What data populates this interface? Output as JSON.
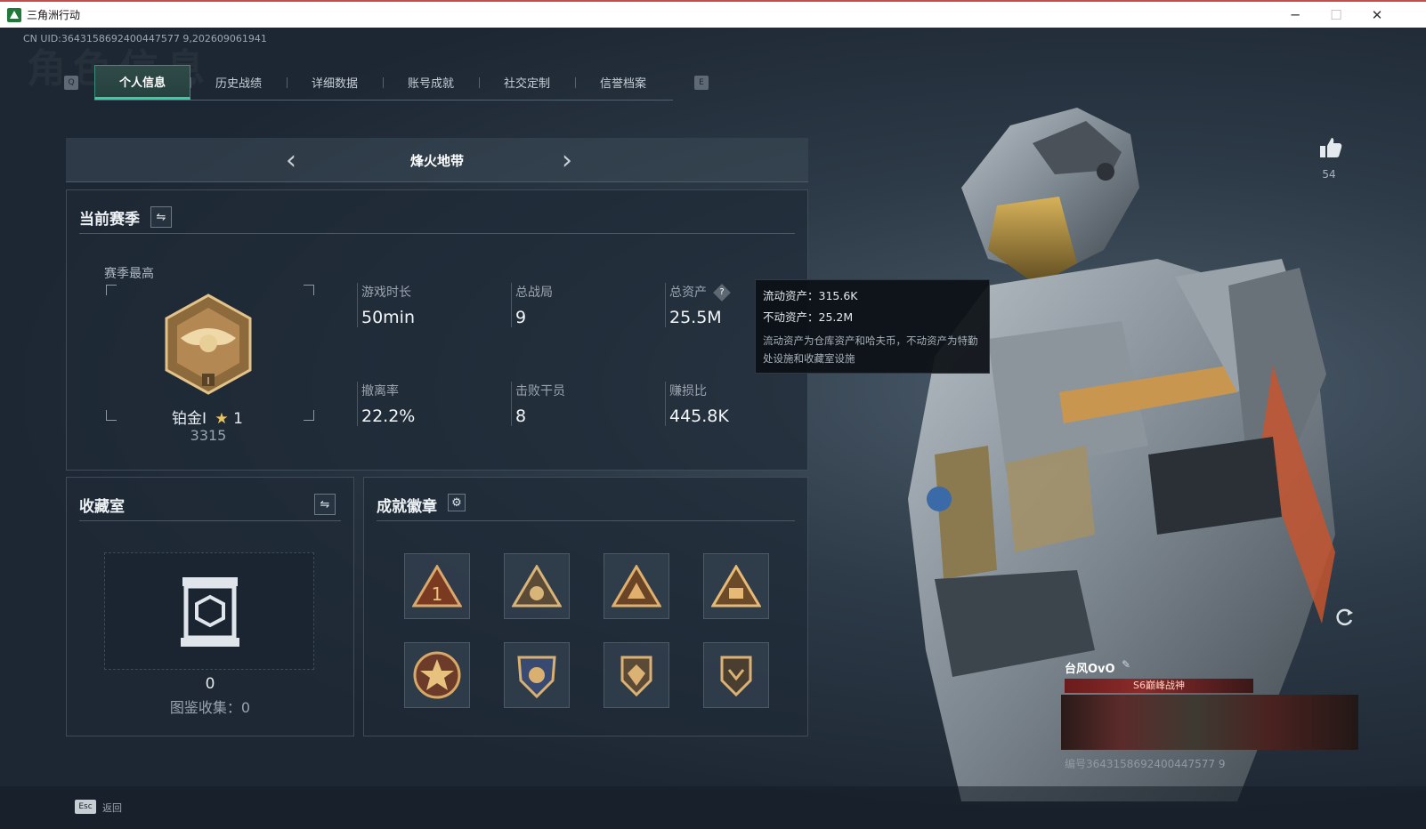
{
  "window": {
    "title": "三角洲行动",
    "minimize": "─",
    "maximize": "☐",
    "close": "✕"
  },
  "header": {
    "uid": "CN UID:3643158692400447577 9,202609061941",
    "watermark": "角色信息"
  },
  "tabs": {
    "left_key": "Q",
    "right_key": "E",
    "items": [
      {
        "label": "个人信息",
        "active": true
      },
      {
        "label": "历史战绩"
      },
      {
        "label": "详细数据"
      },
      {
        "label": "账号成就"
      },
      {
        "label": "社交定制"
      },
      {
        "label": "信誉档案"
      }
    ]
  },
  "mode": {
    "title": "烽火地带",
    "prev": "‹",
    "next": "›"
  },
  "season": {
    "title": "当前赛季",
    "switch_icon": "⇋",
    "best_label": "赛季最高",
    "rank_name": "铂金I",
    "rank_star": "★",
    "rank_star_count": "1",
    "rank_score": "3315",
    "stats": [
      {
        "label": "游戏时长",
        "value": "50min"
      },
      {
        "label": "总战局",
        "value": "9"
      },
      {
        "label": "总资产",
        "value": "25.5M",
        "help": "?"
      },
      {
        "label": "撤离率",
        "value": "22.2%"
      },
      {
        "label": "击败干员",
        "value": "8"
      },
      {
        "label": "赚损比",
        "value": "445.8K"
      }
    ]
  },
  "tooltip": {
    "liquid": "流动资产：315.6K",
    "fixed": "不动资产：25.2M",
    "desc": "流动资产为仓库资产和哈夫币，不动资产为特勤处设施和收藏室设施"
  },
  "collection": {
    "title": "收藏室",
    "switch_icon": "⇋",
    "count": "0",
    "gallery": "图鉴收集：0"
  },
  "achievements": {
    "title": "成就徽章",
    "settings_icon": "⚙"
  },
  "profile": {
    "likes": "54",
    "name": "台风OvO",
    "edit_icon": "✎",
    "card_title": "S6巅峰战神",
    "card_id": "编号3643158692400447577 9"
  },
  "footer": {
    "esc_key": "Esc",
    "esc_label": "返回"
  },
  "colors": {
    "accent": "#2fd3a0",
    "gold": "#c9964f",
    "tooltip_bg": "#0c1016"
  }
}
